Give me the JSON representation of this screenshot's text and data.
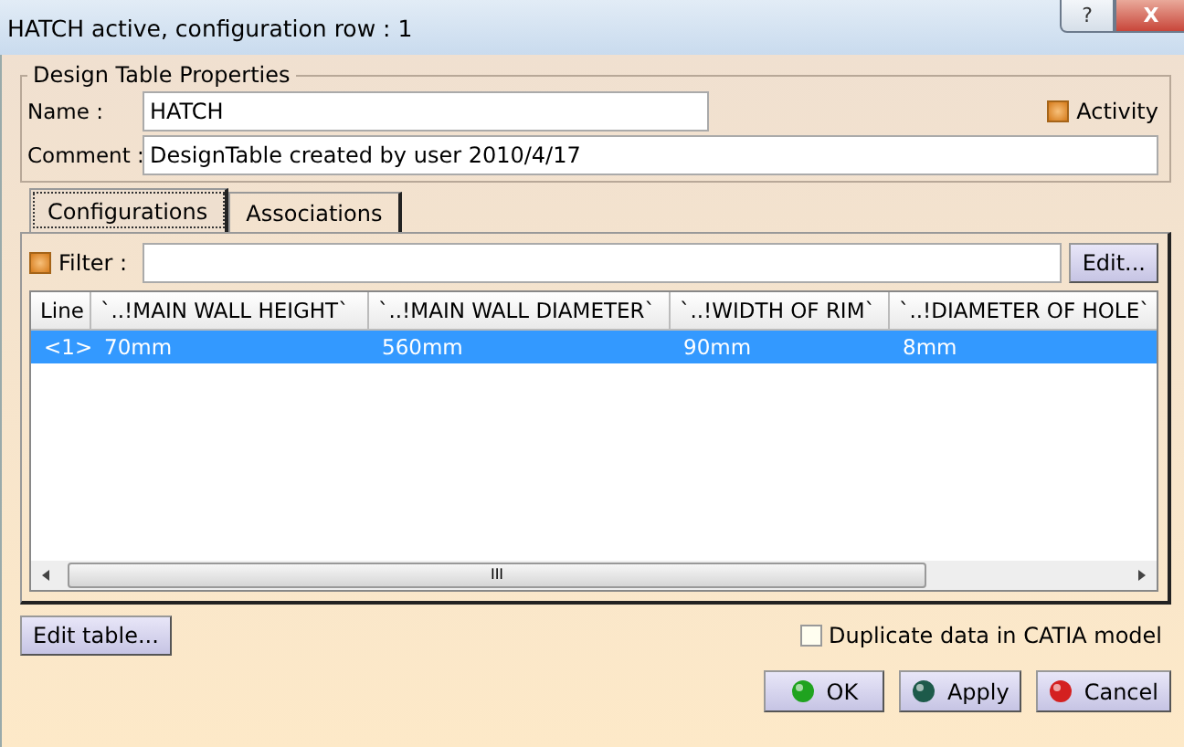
{
  "window": {
    "title": "HATCH active, configuration row : 1",
    "controls": [
      "?",
      "X"
    ]
  },
  "properties": {
    "legend": "Design Table Properties",
    "name_label": "Name :",
    "name_value": "HATCH",
    "comment_label": "Comment :",
    "comment_value": "DesignTable created by user 2010/4/17",
    "activity": {
      "label": "Activity",
      "checked": true
    }
  },
  "tabs": [
    {
      "label": "Configurations",
      "selected": true
    },
    {
      "label": "Associations",
      "selected": false
    }
  ],
  "filter": {
    "label": "Filter :",
    "checked": true,
    "button": "Edit..."
  },
  "table": {
    "columns": [
      "Line",
      "`..!MAIN WALL HEIGHT`",
      "`..!MAIN WALL DIAMETER`",
      "`..!WIDTH OF RIM`",
      "`..!DIAMETER OF HOLE`"
    ],
    "rows": [
      {
        "cells": [
          "<1>",
          "70mm",
          "560mm",
          "90mm",
          "8mm"
        ],
        "selected": true
      }
    ],
    "scroll_grip": "III"
  },
  "edit_table_button": "Edit table...",
  "duplicate": {
    "label": "Duplicate data in CATIA model",
    "checked": false
  },
  "buttons": [
    {
      "label": "OK",
      "kind": "ok"
    },
    {
      "label": "Apply",
      "kind": "apply"
    },
    {
      "label": "Cancel",
      "kind": "cancel"
    }
  ]
}
